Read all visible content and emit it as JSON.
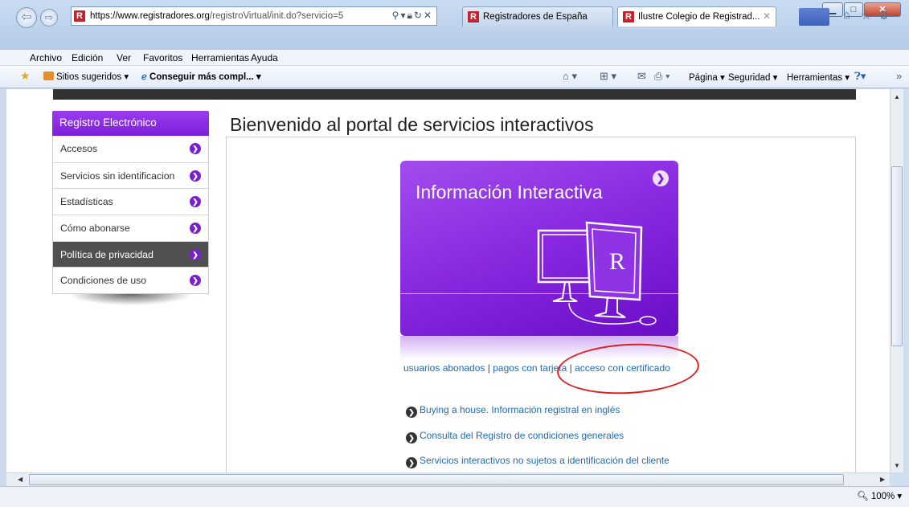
{
  "browser": {
    "url_host": "https://www.registradores.org",
    "url_path": "/registroVirtual/init.do?servicio=5",
    "tabs": [
      {
        "title": "Registradores de España"
      },
      {
        "title": "Ilustre Colegio de Registrad..."
      }
    ],
    "menu": [
      "Archivo",
      "Edición",
      "Ver",
      "Favoritos",
      "Herramientas",
      "Ayuda"
    ],
    "favorites": {
      "suggested_sites": "Sitios sugeridos ▾",
      "get_more": "Conseguir más compl... ▾"
    },
    "toolbar": {
      "page": "Página ▾",
      "security": "Seguridad ▾",
      "tools": "Herramientas ▾"
    },
    "zoom": "100%"
  },
  "sidebar": {
    "header": "Registro Electrónico",
    "items": [
      {
        "label": "Accesos"
      },
      {
        "label": "Servicios sin identificacion"
      },
      {
        "label": "Estadísticas"
      },
      {
        "label": "Cómo abonarse"
      },
      {
        "label": "Política de privacidad"
      },
      {
        "label": "Condiciones de uso"
      }
    ]
  },
  "main": {
    "title": "Bienvenido al portal de servicios interactivos",
    "banner_title": "Información Interactiva",
    "access_links": {
      "subscribed": "usuarios abonados",
      "card": "pagos con tarjeta",
      "certificate": "acceso con certificado",
      "separator": " | "
    },
    "services": [
      {
        "label": "Buying a house. Información registral en inglés"
      },
      {
        "label": "Consulta del Registro de condiciones generales"
      },
      {
        "label": "Servicios interactivos no sujetos a identificación del cliente"
      }
    ]
  },
  "colors": {
    "brand_purple": "#8a2be2",
    "link_blue": "#1e6ab2",
    "annotation_red": "#e02020"
  }
}
